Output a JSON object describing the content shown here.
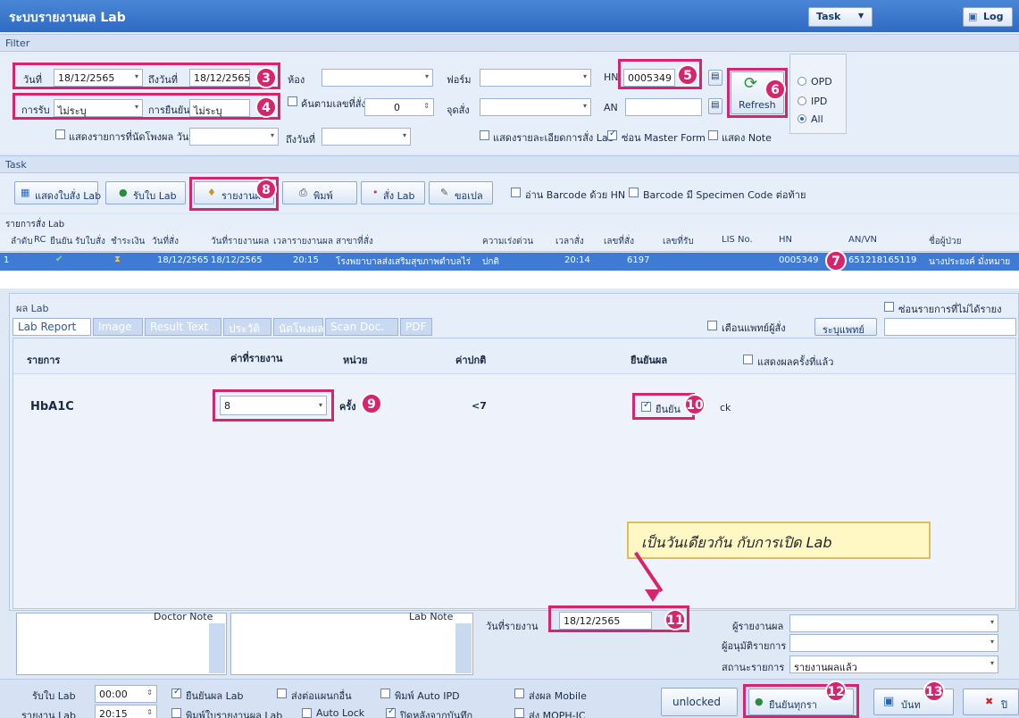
{
  "app": {
    "title": "ระบบรายงานผล Lab",
    "task_menu": "Task",
    "log_button": "Log"
  },
  "filter": {
    "section_label": "Filter",
    "date_from_label": "วันที่",
    "date_from": "18/12/2565",
    "date_to_label": "ถึงวันที่",
    "date_to": "18/12/2565",
    "room_label": "ห้อง",
    "form_label": "ฟอร์ม",
    "hn_label": "HN",
    "hn_value": "0005349",
    "receive_label": "การรับ",
    "receive_value": "ไม่ระบุ",
    "confirm_label": "การยืนยัน",
    "confirm_value": "ไม่ระบุ",
    "search_order_label": "ค้นตามเลขที่สั่ง",
    "search_order_value": "0",
    "order_point_label": "จุดสั่ง",
    "an_label": "AN",
    "show_unsent_label": "แสดงรายการที่นัดโพงผล วันที่",
    "to_date_label": "ถึงวันที่",
    "show_order_detail_label": "แสดงรายละเอียดการสั่ง Lab",
    "hide_master_label": "ซ่อน Master Form",
    "show_note_label": "แสดง Note",
    "refresh_label": "Refresh",
    "radio": [
      "OPD",
      "IPD",
      "All"
    ]
  },
  "task": {
    "section_label": "Task",
    "buttons": [
      "แสดงใบสั่ง Lab",
      "รับใบ Lab",
      "รายงานผล",
      "พิมพ์",
      "สั่ง Lab",
      "ขอเปล"
    ],
    "barcode_hn_label": "อ่าน Barcode ด้วย HN",
    "barcode_specimen_label": "Barcode มี Specimen Code ต่อท้าย"
  },
  "orders": {
    "section_label": "รายการสั่ง Lab",
    "columns": [
      "ลำดับ",
      "RC",
      "ยืนยัน",
      "รับใบสั่ง",
      "ชำระเงิน",
      "วันที่สั่ง",
      "วันที่รายงานผล",
      "เวลารายงานผล",
      "สาขาที่สั่ง",
      "ความเร่งด่วน",
      "เวลาสั่ง",
      "เลขที่สั่ง",
      "เลขที่รับ",
      "LIS No.",
      "HN",
      "AN/VN",
      "ชื่อผู้ป่วย"
    ],
    "row": [
      "1",
      "",
      "",
      "",
      "",
      "18/12/2565",
      "18/12/2565",
      "20:15",
      "โรงพยาบาลส่งเสริมสุขภาพตำบลไร่",
      "ปกติ",
      "20:14",
      "6197",
      "",
      "",
      "0005349",
      "651218165119",
      "นางประยงค์ มั่งหมาย"
    ]
  },
  "lab_result": {
    "section_label": "ผล Lab",
    "hide_unreported_label": "ซ่อนรายการที่ไม่ได้รายง",
    "tabs": [
      "Lab Report",
      "Image",
      "Result Text",
      "ประวัติ",
      "นัดโพงผล",
      "Scan Doc.",
      "PDF"
    ],
    "notify_doctor_label": "เตือนแพทย์ผู้สั่ง",
    "doctor_button": "ระบุแพทย์",
    "headers": {
      "item": "รายการ",
      "value": "ค่าที่รายงาน",
      "unit": "หน่วย",
      "normal": "ค่าปกติ",
      "confirm": "ยืนยันผล",
      "show_last": "แสดงผลครั้งที่แล้ว"
    },
    "item_name": "HbA1C",
    "item_value": "8",
    "item_unit": "ครั้ง",
    "item_normal": "<7",
    "confirm_label": "ยืนยัน",
    "lock_label": "ck",
    "callout": "เป็นวันเดียวกัน กับการเปิด Lab",
    "doctor_note_label": "Doctor Note",
    "lab_note_label": "Lab Note",
    "report_date_label": "วันที่รายงาน",
    "report_date": "18/12/2565",
    "reporter_label": "ผู้รายงานผล",
    "approver_label": "ผู้อนุมัติรายการ",
    "status_label": "สถานะรายการ",
    "status_value": "รายงานผลแล้ว"
  },
  "bottom": {
    "receive_lab_label": "รับใบ Lab",
    "receive_lab_time": "00:00",
    "report_lab_label": "รายงาน Lab",
    "report_lab_time": "20:15",
    "confirm_lab_label": "ยืนยันผล Lab",
    "send_outside_label": "ส่งต่อแผนกอื่น",
    "print_auto_ipd_label": "พิมพ์ Auto IPD",
    "send_mobile_label": "ส่งผล Mobile",
    "print_report_label": "พิมพ์ใบรายงานผล Lab",
    "auto_lock_label": "Auto Lock",
    "close_after_save_label": "ปิดหลังจากบันทึก",
    "send_moph_label": "ส่ง MOPH-IC",
    "unlocked_label": "unlocked",
    "confirm_all_label": "ยืนยันทุกรา",
    "save_label": "บันท",
    "close_label": "ปิ"
  },
  "markers": [
    "3",
    "4",
    "5",
    "6",
    "7",
    "8",
    "9",
    "10",
    "11",
    "12",
    "13"
  ]
}
